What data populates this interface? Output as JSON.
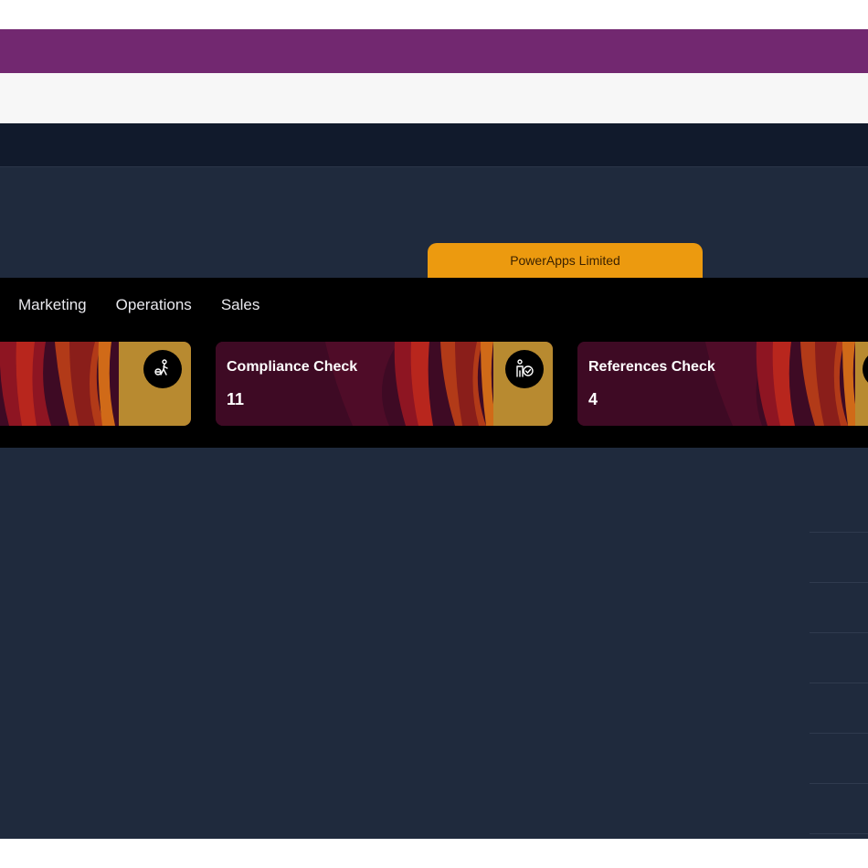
{
  "header": {
    "organization_tab": "PowerApps Limited"
  },
  "departments": [
    "Marketing",
    "Operations",
    "Sales"
  ],
  "cards": [
    {
      "title": "",
      "count": "",
      "icon": "onboarding-icon"
    },
    {
      "title": "Compliance Check",
      "count": "11",
      "icon": "compliance-icon"
    },
    {
      "title": "References Check",
      "count": "4",
      "icon": "references-icon"
    }
  ],
  "colors": {
    "top_bar": "#722870",
    "nav_band": "#111a2c",
    "content_bg": "#1f2a3d",
    "org_tab": "#ec9a0f",
    "card_bg": "#3e0a24",
    "card_accent": "#b88a30"
  }
}
